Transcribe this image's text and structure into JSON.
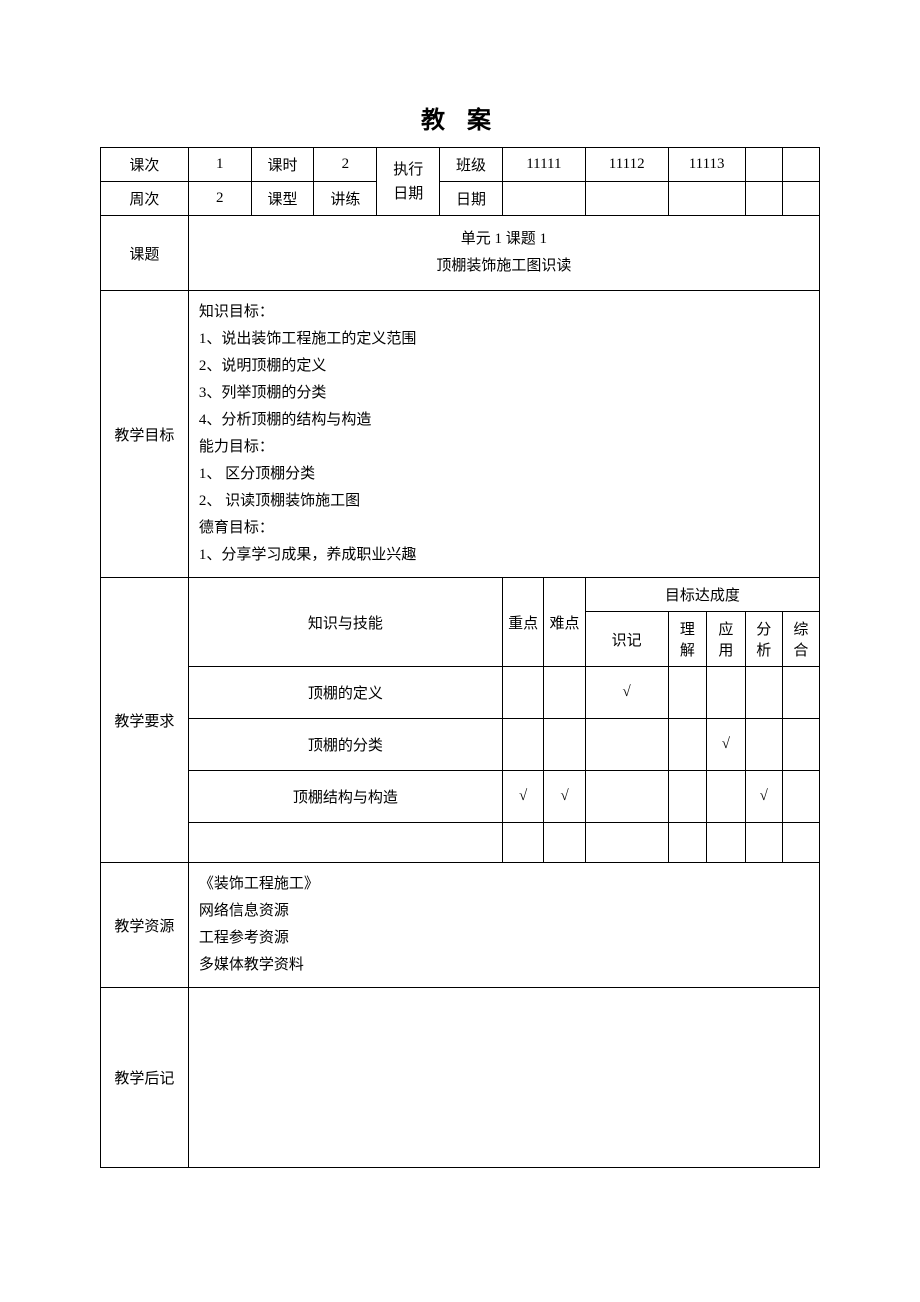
{
  "title": "教 案",
  "header": {
    "lesson_num_label": "课次",
    "lesson_num_value": "1",
    "period_label": "课时",
    "period_value": "2",
    "exec_date_label": "执行\n日期",
    "class_label": "班级",
    "class1": "11111",
    "class2": "11112",
    "class3": "11113",
    "week_label": "周次",
    "week_value": "2",
    "type_label": "课型",
    "type_value": "讲练",
    "date_label": "日期"
  },
  "topic": {
    "label": "课题",
    "line1": "单元 1 课题 1",
    "line2": "顶棚装饰施工图识读"
  },
  "objectives": {
    "label": "教学目标",
    "lines": [
      "知识目标：",
      "1、说出装饰工程施工的定义范围",
      "2、说明顶棚的定义",
      "3、列举顶棚的分类",
      "4、分析顶棚的结构与构造",
      "能力目标：",
      "1、 区分顶棚分类",
      "2、 识读顶棚装饰施工图",
      "德育目标：",
      "1、分享学习成果，养成职业兴趣"
    ]
  },
  "requirements": {
    "label": "教学要求",
    "knowledge_skill_label": "知识与技能",
    "keypoint_label": "重点",
    "difficulty_label": "难点",
    "achievement_label": "目标达成度",
    "levels": [
      "识记",
      "理解",
      "应用",
      "分析",
      "综合"
    ],
    "rows": [
      {
        "name": "顶棚的定义",
        "key": "",
        "diff": "",
        "l1": "√",
        "l2": "",
        "l3": "",
        "l4": "",
        "l5": ""
      },
      {
        "name": "顶棚的分类",
        "key": "",
        "diff": "",
        "l1": "",
        "l2": "",
        "l3": "√",
        "l4": "",
        "l5": ""
      },
      {
        "name": "顶棚结构与构造",
        "key": "√",
        "diff": "√",
        "l1": "",
        "l2": "",
        "l3": "",
        "l4": "√",
        "l5": ""
      }
    ]
  },
  "resources": {
    "label": "教学资源",
    "lines": [
      "《装饰工程施工》",
      "网络信息资源",
      "工程参考资源",
      "多媒体教学资料"
    ]
  },
  "postscript": {
    "label": "教学后记"
  }
}
